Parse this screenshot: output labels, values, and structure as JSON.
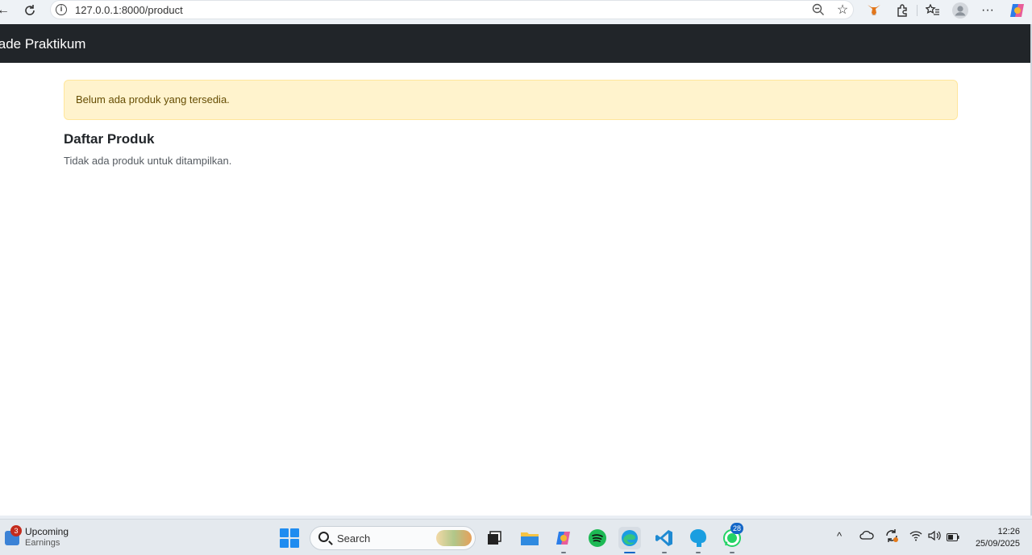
{
  "browser": {
    "url": "127.0.0.1:8000/product",
    "icons": [
      "back-icon",
      "refresh-icon",
      "info-icon",
      "zoom-out-icon",
      "star-icon",
      "metamask-icon",
      "extensions-icon",
      "favorites-icon",
      "profile-icon",
      "more-icon",
      "copilot-icon"
    ]
  },
  "navbar": {
    "brand": "lade Praktikum"
  },
  "alert": {
    "text": "Belum ada produk yang tersedia."
  },
  "section": {
    "heading": "Daftar Produk",
    "empty_text": "Tidak ada produk untuk ditampilkan."
  },
  "taskbar": {
    "widget": {
      "badge": "3",
      "title": "Upcoming",
      "subtitle": "Earnings"
    },
    "search_label": "Search",
    "apps": [
      "task-view-icon",
      "file-explorer-icon",
      "copilot-app-icon",
      "spotify-icon",
      "edge-icon",
      "vscode-icon",
      "browser-app-icon",
      "whatsapp-icon"
    ],
    "whatsapp_badge": "28",
    "tray_icons": [
      "chevron-up-icon",
      "onedrive-icon",
      "sync-icon",
      "wifi-icon",
      "volume-icon",
      "battery-icon"
    ],
    "time": "12:26",
    "date": "25/09/2025"
  },
  "colors": {
    "navbar": "#212529",
    "alert_bg": "#fff3cd",
    "alert_text": "#664d03"
  }
}
